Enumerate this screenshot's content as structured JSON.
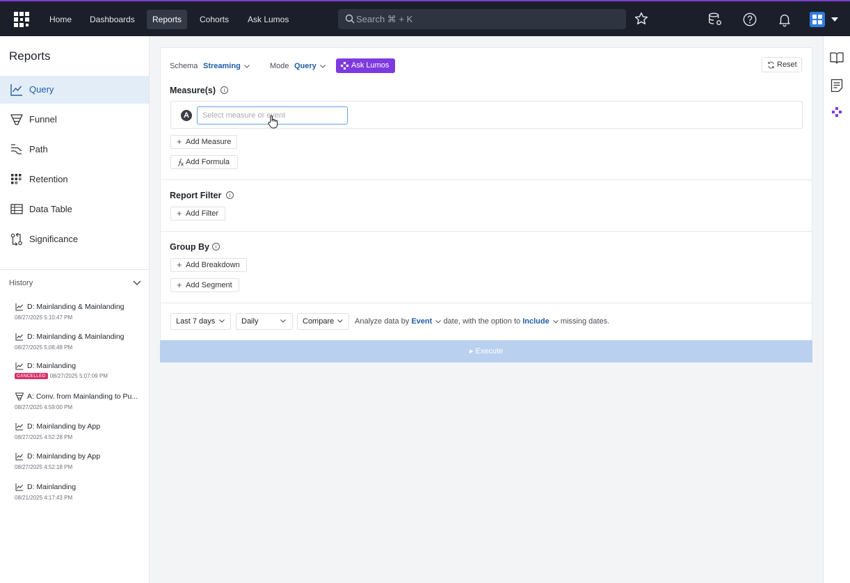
{
  "nav": {
    "links": [
      "Home",
      "Dashboards",
      "Reports",
      "Cohorts",
      "Ask Lumos"
    ],
    "active": "Reports",
    "search_placeholder": "Search ⌘ + K"
  },
  "sidebar": {
    "title": "Reports",
    "items": [
      {
        "label": "Query",
        "icon": "line-chart-icon",
        "active": true
      },
      {
        "label": "Funnel",
        "icon": "funnel-icon"
      },
      {
        "label": "Path",
        "icon": "path-icon"
      },
      {
        "label": "Retention",
        "icon": "retention-grid-icon"
      },
      {
        "label": "Data Table",
        "icon": "table-icon"
      },
      {
        "label": "Significance",
        "icon": "significance-icon"
      }
    ],
    "history_label": "History",
    "history": [
      {
        "title": "D: Mainlanding & Mainlanding",
        "date": "08/27/2025 5:10:47 PM",
        "icon": "line-chart-icon"
      },
      {
        "title": "D: Mainlanding & Mainlanding",
        "date": "08/27/2025 5:08:48 PM",
        "icon": "line-chart-icon"
      },
      {
        "title": "D: Mainlanding",
        "date": "08/27/2025 5:07:09 PM",
        "badge": "CANCELLED",
        "icon": "line-chart-icon"
      },
      {
        "title": "A: Conv. from Mainlanding to Pu...",
        "date": "08/27/2025 4:59:00 PM",
        "icon": "funnel-icon"
      },
      {
        "title": "D: Mainlanding by App",
        "date": "08/27/2025 4:52:28 PM",
        "icon": "line-chart-icon"
      },
      {
        "title": "D: Mainlanding by App",
        "date": "08/27/2025 4:52:18 PM",
        "icon": "line-chart-icon"
      },
      {
        "title": "D: Mainlanding",
        "date": "08/21/2025 4:17:43 PM",
        "icon": "line-chart-icon"
      }
    ]
  },
  "query": {
    "schema_label": "Schema",
    "schema_value": "Streaming",
    "mode_label": "Mode",
    "mode_value": "Query",
    "ask_button": "Ask Lumos",
    "reset_button": "Reset",
    "measures_title": "Measure(s)",
    "measure_letter": "A",
    "measure_placeholder": "Select measure or event",
    "add_measure": "Add Measure",
    "add_formula": "Add Formula",
    "filter_title": "Report Filter",
    "add_filter": "Add Filter",
    "groupby_title": "Group By",
    "add_breakdown": "Add Breakdown",
    "add_segment": "Add Segment",
    "date_range": "Last 7 days",
    "granularity": "Daily",
    "compare": "Compare",
    "sentence_1": "Analyze data by",
    "analyze_by": "Event",
    "sentence_2": "date, with the option to",
    "missing_option": "Include",
    "sentence_3": "missing dates.",
    "execute": "▸ Execute"
  },
  "colors": {
    "nav_bg": "#1b1f2a",
    "accent_purple": "#7e3ae0",
    "link_blue": "#1f5ea8",
    "active_bg": "#e3edf8",
    "execute_bg": "#b9d0ee",
    "badge_pink": "#d9316a"
  }
}
